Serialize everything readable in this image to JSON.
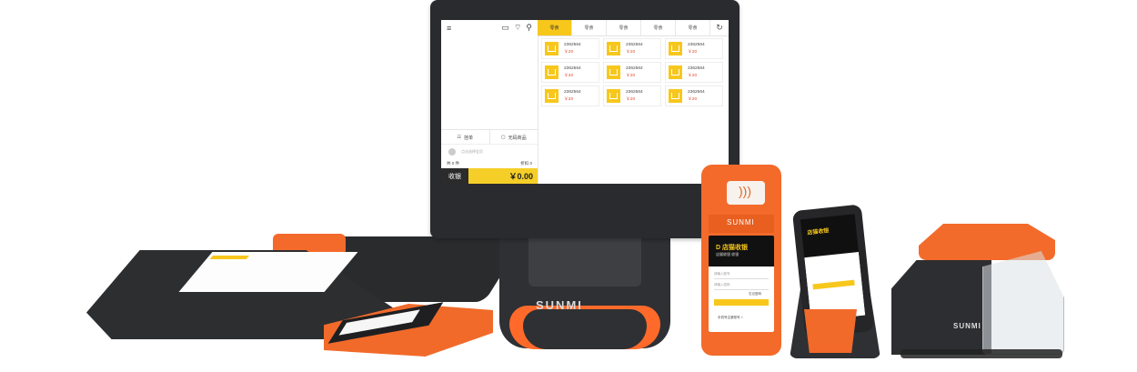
{
  "pos": {
    "topbar_icons": [
      "menu-icon",
      "chat-icon",
      "wifi-icon",
      "search-icon"
    ],
    "tabs": [
      "零食",
      "零食",
      "零食",
      "零食",
      "零食"
    ],
    "refresh_icon": "refresh-icon",
    "products": [
      {
        "code": "2362564",
        "price": "￥20"
      },
      {
        "code": "2362564",
        "price": "￥20"
      },
      {
        "code": "2362564",
        "price": "￥20"
      },
      {
        "code": "2362564",
        "price": "￥20"
      },
      {
        "code": "2362564",
        "price": "￥20"
      },
      {
        "code": "2362564",
        "price": "￥20"
      },
      {
        "code": "2362564",
        "price": "￥20"
      },
      {
        "code": "2362564",
        "price": "￥20"
      },
      {
        "code": "2362564",
        "price": "￥20"
      }
    ],
    "cart_actions": [
      "挂单",
      "无码商品"
    ],
    "member_placeholder": "点击选择会员",
    "count": "共 0 件",
    "discount": "折扣 0",
    "checkout_label": "收银",
    "total": "￥0.00",
    "brand": "SUNMI"
  },
  "handheld": {
    "brand": "SUNMI",
    "app_logo": "D 店猫收银",
    "app_sub": "店猫收银 收银",
    "fields": [
      "请输入账号",
      "请输入密码"
    ],
    "link": "忘记密码",
    "footer": "手机号注册账号 >"
  },
  "phone": {
    "app_logo": "店猫收银"
  },
  "kiosk": {
    "brand": "SUNMI"
  },
  "colors": {
    "accent_yellow": "#f7c71c",
    "device_orange": "#f36a2b",
    "device_dark": "#2d2e31",
    "price_red": "#e04b2a"
  }
}
